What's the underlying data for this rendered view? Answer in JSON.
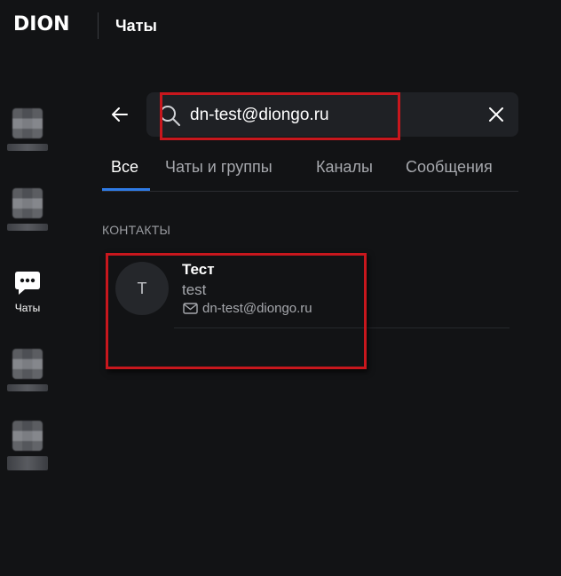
{
  "header": {
    "logo": "DION",
    "title": "Чаты"
  },
  "sidebar": {
    "items": [
      {
        "label": "",
        "icon": "blurred-app-icon"
      },
      {
        "label": "",
        "icon": "blurred-app-icon"
      },
      {
        "label": "Чаты",
        "icon": "chat-bubble-icon"
      },
      {
        "label": "",
        "icon": "blurred-app-icon"
      },
      {
        "label": "",
        "icon": "blurred-app-icon"
      }
    ]
  },
  "search": {
    "value": "dn-test@diongo.ru",
    "placeholder": ""
  },
  "tabs": [
    {
      "label": "Все",
      "active": true
    },
    {
      "label": "Чаты и группы",
      "active": false
    },
    {
      "label": "Каналы",
      "active": false
    },
    {
      "label": "Сообщения",
      "active": false
    }
  ],
  "contacts": {
    "section_title": "КОНТАКТЫ",
    "items": [
      {
        "avatar_letter": "Т",
        "name": "Тест",
        "login": "test",
        "email": "dn-test@diongo.ru"
      }
    ]
  },
  "colors": {
    "background": "#121315",
    "accent": "#2f7be6",
    "annotation": "#c8171d"
  }
}
